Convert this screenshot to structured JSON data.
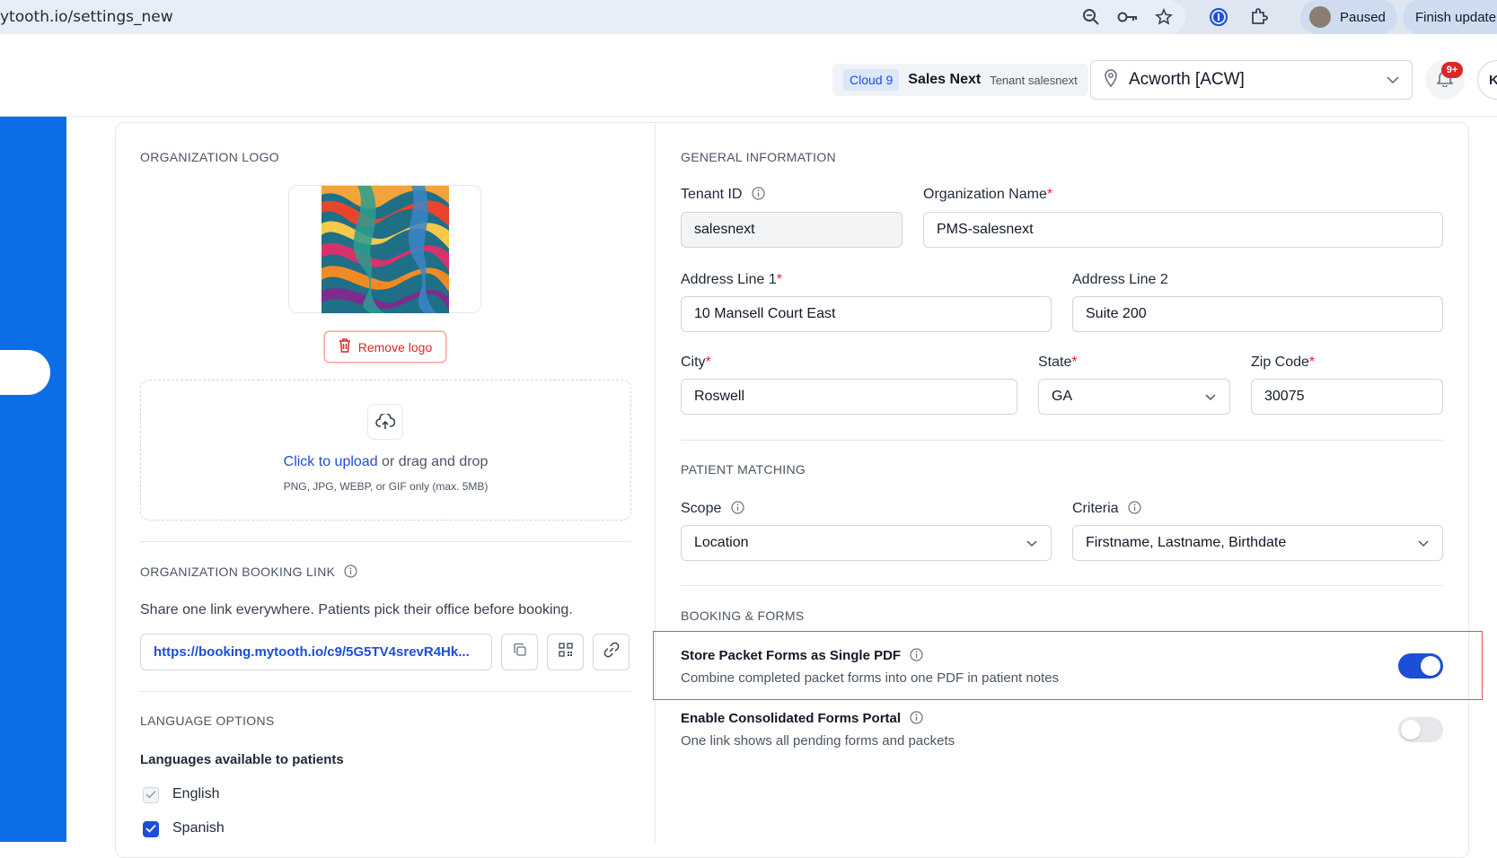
{
  "browser": {
    "url": "ytooth.io/settings_new",
    "profile_status": "Paused",
    "update_label": "Finish update"
  },
  "header": {
    "cloud_badge": "Cloud 9",
    "tenant_name": "Sales Next",
    "tenant_sub": "Tenant salesnext",
    "location": "Acworth [ACW]",
    "notification_count": "9+",
    "avatar_initial": "K"
  },
  "logo_section": {
    "title": "ORGANIZATION LOGO",
    "remove_label": "Remove logo",
    "upload_link": "Click to upload",
    "upload_rest": " or drag and drop",
    "upload_hint": "PNG, JPG, WEBP, or GIF only (max. 5MB)"
  },
  "booking_link": {
    "title": "ORGANIZATION BOOKING LINK",
    "description": "Share one link everywhere. Patients pick their office before booking.",
    "url": "https://booking.mytooth.io/c9/5G5TV4srevR4Hk..."
  },
  "languages": {
    "title": "LANGUAGE OPTIONS",
    "subtitle": "Languages available to patients",
    "items": [
      {
        "label": "English",
        "checked": true,
        "locked": true
      },
      {
        "label": "Spanish",
        "checked": true,
        "locked": false
      }
    ]
  },
  "general": {
    "title": "GENERAL INFORMATION",
    "tenant_id_label": "Tenant ID",
    "tenant_id_value": "salesnext",
    "org_name_label": "Organization Name",
    "org_name_value": "PMS-salesnext",
    "address1_label": "Address Line 1",
    "address1_value": "10 Mansell Court East",
    "address2_label": "Address Line 2",
    "address2_value": "Suite 200",
    "city_label": "City",
    "city_value": "Roswell",
    "state_label": "State",
    "state_value": "GA",
    "zip_label": "Zip Code",
    "zip_value": "30075",
    "required_mark": "*"
  },
  "matching": {
    "title": "PATIENT MATCHING",
    "scope_label": "Scope",
    "scope_value": "Location",
    "criteria_label": "Criteria",
    "criteria_value": "Firstname, Lastname, Birthdate"
  },
  "booking_forms": {
    "title": "BOOKING & FORMS",
    "store_pdf_title": "Store Packet Forms as Single PDF",
    "store_pdf_desc": "Combine completed packet forms into one PDF in patient notes",
    "store_pdf_enabled": true,
    "portal_title": "Enable Consolidated Forms Portal",
    "portal_desc": "One link shows all pending forms and packets",
    "portal_enabled": false
  },
  "colors": {
    "primary": "#1d4ed8",
    "sidebar": "#0b6ee6",
    "danger": "#dc2626",
    "highlight_border": "#e05252"
  }
}
